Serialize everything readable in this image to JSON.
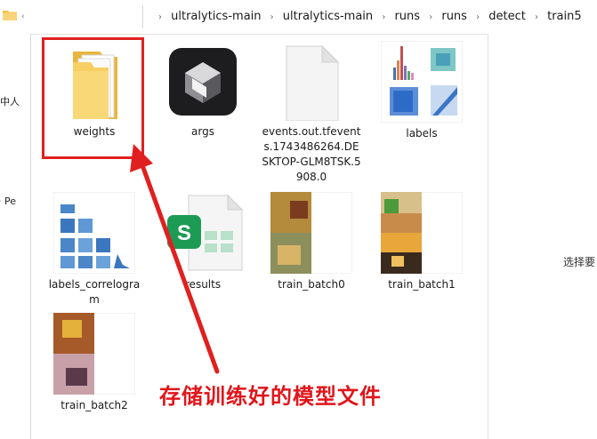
{
  "address": {
    "crumbs": [
      "ultralytics-main",
      "ultralytics-main",
      "runs",
      "runs",
      "detect",
      "train5"
    ]
  },
  "nav_pane": {
    "label_1": "中人",
    "label_2": "Pe"
  },
  "files": [
    {
      "name": "weights",
      "type": "folder-icon"
    },
    {
      "name": "args",
      "type": "app-icon"
    },
    {
      "name": "events.out.tfevents.1743486264.DESKTOP-GLM8TSK.5908.0",
      "type": "document-icon"
    },
    {
      "name": "labels",
      "type": "image-thumbnail"
    },
    {
      "name": "labels_correlogram",
      "type": "image-thumbnail"
    },
    {
      "name": "results",
      "type": "spreadsheet-icon"
    },
    {
      "name": "train_batch0",
      "type": "image-thumbnail"
    },
    {
      "name": "train_batch1",
      "type": "image-thumbnail"
    },
    {
      "name": "train_batch2",
      "type": "image-thumbnail"
    }
  ],
  "annotation": {
    "caption": "存储训练好的模型文件",
    "color": "#e0161b"
  },
  "details_pane": {
    "hint": "选择要"
  },
  "colors": {
    "folder": "#f5c94c",
    "accent_red": "#e02020",
    "sheet_green": "#1d9b55"
  }
}
